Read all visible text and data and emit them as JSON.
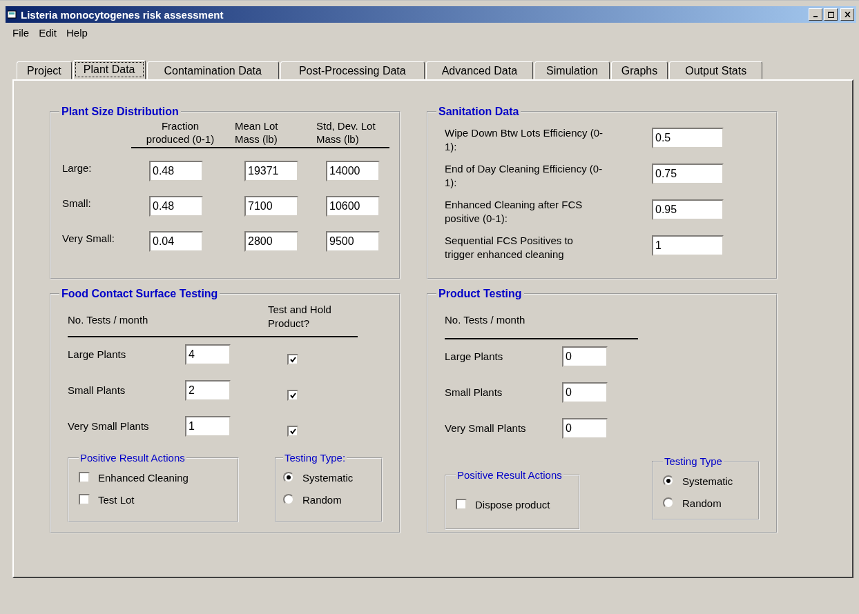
{
  "window": {
    "title": "Listeria monocytogenes risk assessment"
  },
  "menu": [
    "File",
    "Edit",
    "Help"
  ],
  "tabs": [
    {
      "label": "Project",
      "selected": false
    },
    {
      "label": "Plant Data",
      "selected": true
    },
    {
      "label": "Contamination Data",
      "selected": false
    },
    {
      "label": "Post-Processing Data",
      "selected": false
    },
    {
      "label": "Advanced Data",
      "selected": false
    },
    {
      "label": "Simulation",
      "selected": false
    },
    {
      "label": "Graphs",
      "selected": false
    },
    {
      "label": "Output Stats",
      "selected": false
    }
  ],
  "plant_size": {
    "title": "Plant Size Distribution",
    "columns": [
      "Fraction produced (0-1)",
      "Mean Lot Mass (lb)",
      "Std, Dev. Lot Mass (lb)"
    ],
    "rows": [
      {
        "label": "Large:",
        "values": [
          "0.48",
          "19371",
          "14000"
        ]
      },
      {
        "label": "Small:",
        "values": [
          "0.48",
          "7100",
          "10600"
        ]
      },
      {
        "label": "Very Small:",
        "values": [
          "0.04",
          "2800",
          "9500"
        ]
      }
    ]
  },
  "sanitation": {
    "title": "Sanitation Data",
    "fields": [
      {
        "label": "Wipe Down Btw Lots Efficiency (0-1):",
        "value": "0.5"
      },
      {
        "label": "End of Day Cleaning Efficiency (0-1):",
        "value": "0.75"
      },
      {
        "label": "Enhanced Cleaning after FCS positive (0-1):",
        "value": "0.95"
      },
      {
        "label": "Sequential FCS Positives to trigger enhanced cleaning",
        "value": "1"
      }
    ]
  },
  "fcs_testing": {
    "title": "Food Contact Surface Testing",
    "tests_heading": "No. Tests / month",
    "hold_heading": "Test and Hold Product?",
    "rows": [
      {
        "label": "Large Plants",
        "value": "4",
        "checked": true
      },
      {
        "label": "Small Plants",
        "value": "2",
        "checked": true
      },
      {
        "label": "Very Small Plants",
        "value": "1",
        "checked": true
      }
    ],
    "actions": {
      "title": "Positive Result Actions",
      "options": [
        {
          "label": "Enhanced Cleaning",
          "checked": false
        },
        {
          "label": "Test Lot",
          "checked": false
        }
      ]
    },
    "testing_type": {
      "title": "Testing Type:",
      "options": [
        {
          "label": "Systematic",
          "selected": true
        },
        {
          "label": "Random",
          "selected": false
        }
      ]
    }
  },
  "product_testing": {
    "title": "Product Testing",
    "tests_heading": "No. Tests / month",
    "rows": [
      {
        "label": "Large Plants",
        "value": "0"
      },
      {
        "label": "Small Plants",
        "value": "0"
      },
      {
        "label": "Very Small Plants",
        "value": "0"
      }
    ],
    "actions": {
      "title": "Positive Result Actions",
      "options": [
        {
          "label": "Dispose product",
          "checked": false
        }
      ]
    },
    "testing_type": {
      "title": "Testing Type",
      "options": [
        {
          "label": "Systematic",
          "selected": true
        },
        {
          "label": "Random",
          "selected": false
        }
      ]
    }
  }
}
